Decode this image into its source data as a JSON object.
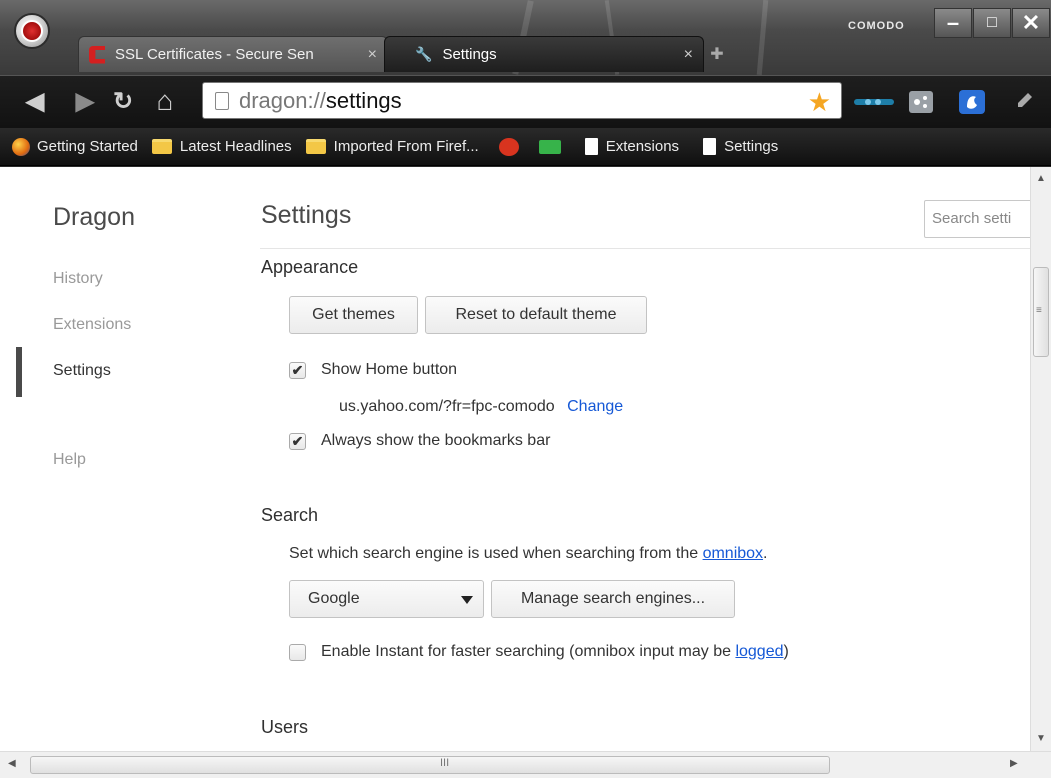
{
  "window": {
    "brand": "COMODO",
    "minimize": "–",
    "maximize": "□",
    "close": "✕"
  },
  "tabs": [
    {
      "title": "SSL Certificates - Secure Sen",
      "close": "×",
      "active": false,
      "icon": "ssl-favicon"
    },
    {
      "title": "Settings",
      "close": "×",
      "active": true,
      "icon": "wrench-icon"
    }
  ],
  "toolbar": {
    "back": "◀",
    "forward": "▶",
    "reload": "↻",
    "home": "⌂",
    "url_scheme": "dragon://",
    "url_rest": "settings",
    "star": "★"
  },
  "bookmarks": [
    {
      "label": "Getting Started",
      "icon": "firefox-icon"
    },
    {
      "label": "Latest Headlines",
      "icon": "folder-icon"
    },
    {
      "label": "Imported From Firef...",
      "icon": "folder-icon"
    },
    {
      "label": "",
      "icon": "angry-bird-icon"
    },
    {
      "label": "",
      "icon": "green-icon"
    },
    {
      "label": "Extensions",
      "icon": "page-icon"
    },
    {
      "label": "Settings",
      "icon": "page-icon"
    }
  ],
  "sidebar": {
    "brand": "Dragon",
    "items": [
      {
        "label": "History"
      },
      {
        "label": "Extensions"
      },
      {
        "label": "Settings"
      },
      {
        "label": "Help"
      }
    ]
  },
  "main": {
    "title": "Settings",
    "search_placeholder": "Search setti",
    "appearance": {
      "title": "Appearance",
      "get_themes": "Get themes",
      "reset_theme": "Reset to default theme",
      "show_home": "Show Home button",
      "home_url": "us.yahoo.com/?fr=fpc-comodo",
      "change": "Change",
      "show_bookmarks": "Always show the bookmarks bar"
    },
    "search": {
      "title": "Search",
      "desc_before": "Set which search engine is used when searching from the ",
      "desc_link": "omnibox",
      "desc_after": ".",
      "engine": "Google",
      "manage": "Manage search engines...",
      "instant_before": "Enable Instant for faster searching (omnibox input may be ",
      "instant_link": "logged",
      "instant_after": ")"
    },
    "users": {
      "title": "Users"
    }
  },
  "scroll": {
    "up": "▲",
    "down": "▼",
    "left": "◀",
    "right": "▶",
    "v_grip": "≡",
    "h_grip": "III"
  }
}
